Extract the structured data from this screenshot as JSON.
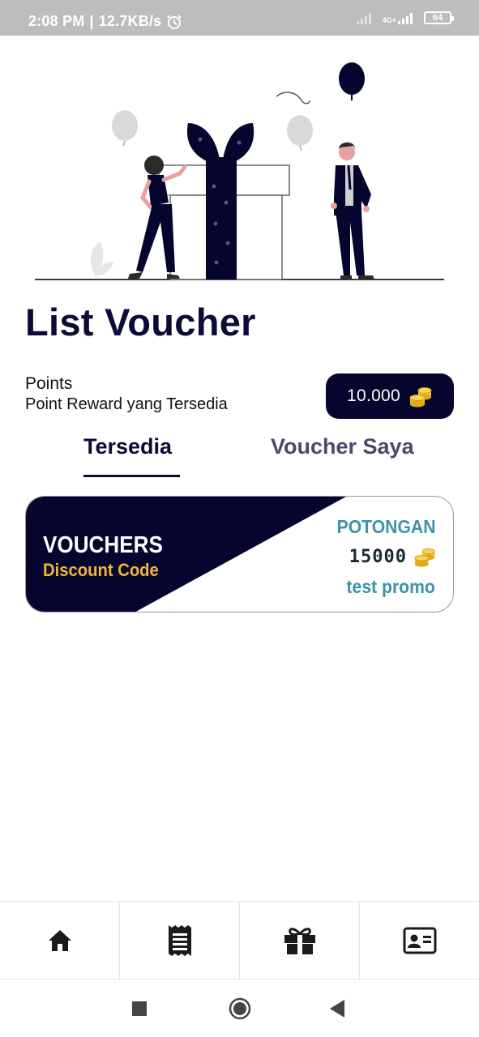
{
  "status_bar": {
    "time": "2:08 PM",
    "speed": "12.7KB/s",
    "network": "4G+",
    "battery": "64",
    "icons": [
      "alarm-icon",
      "signal-icon",
      "battery-icon"
    ]
  },
  "title": "List Voucher",
  "points": {
    "title": "Points",
    "subtitle": "Point Reward yang Tersedia",
    "value": "10.000",
    "icon": "coins-icon"
  },
  "tabs": [
    {
      "label": "Tersedia",
      "active": true
    },
    {
      "label": "Voucher Saya",
      "active": false
    }
  ],
  "vouchers": [
    {
      "heading": "VOUCHERS",
      "subheading": "Discount Code",
      "label": "POTONGAN",
      "amount": "15000",
      "name": "test promo"
    }
  ],
  "bottom_nav": [
    "home-icon",
    "receipt-icon",
    "gift-icon",
    "id-card-icon"
  ],
  "system_nav": [
    "recents-button",
    "home-button",
    "back-button"
  ],
  "colors": {
    "primary": "#05052e",
    "accent": "#f2b53b",
    "teal": "#3d93a8",
    "status_bar": "#bdbdbd"
  }
}
